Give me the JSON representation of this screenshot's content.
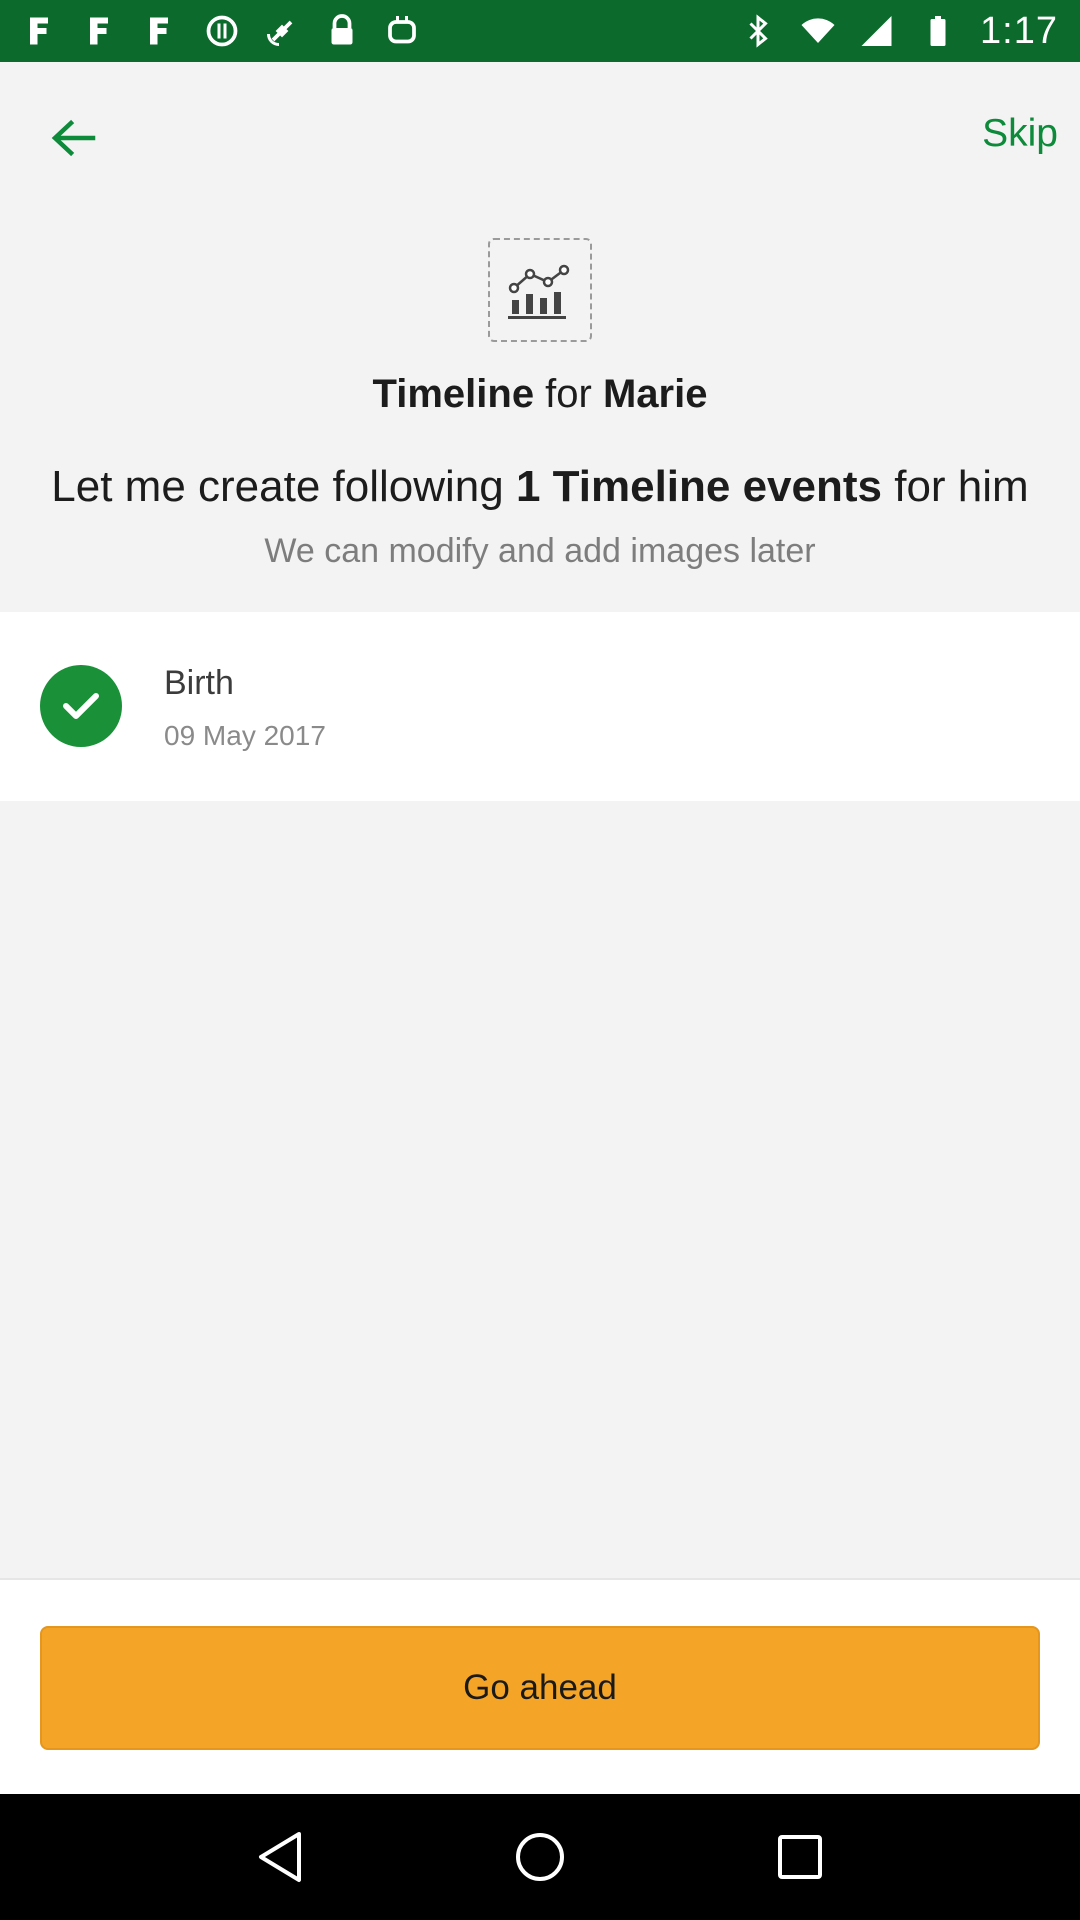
{
  "status_bar": {
    "time": "1:17",
    "icons_left": [
      "notification-f-icon",
      "notification-f-icon",
      "notification-f-icon",
      "data-saver-icon",
      "fake-gps-icon",
      "lock-icon",
      "android-icon"
    ],
    "icons_right": [
      "bluetooth-icon",
      "wifi-icon",
      "signal-icon",
      "battery-icon"
    ]
  },
  "app_bar": {
    "skip_label": "Skip",
    "back_icon": "arrow-left-icon"
  },
  "header": {
    "icon": "chart-icon",
    "title_prefix": "Timeline",
    "title_middle": " for ",
    "title_name": "Marie",
    "headline_pre": "Let me create following ",
    "headline_bold": "1 Timeline events",
    "headline_post": " for him",
    "subline": "We can modify and add images later"
  },
  "events": [
    {
      "title": "Birth",
      "date": "09 May 2017",
      "checked": true
    }
  ],
  "actions": {
    "go_ahead_label": "Go ahead"
  },
  "colors": {
    "status_bar": "#0b6a2c",
    "accent_green": "#0d8a3a",
    "check_green": "#1a9138",
    "button_orange": "#f4a527"
  }
}
